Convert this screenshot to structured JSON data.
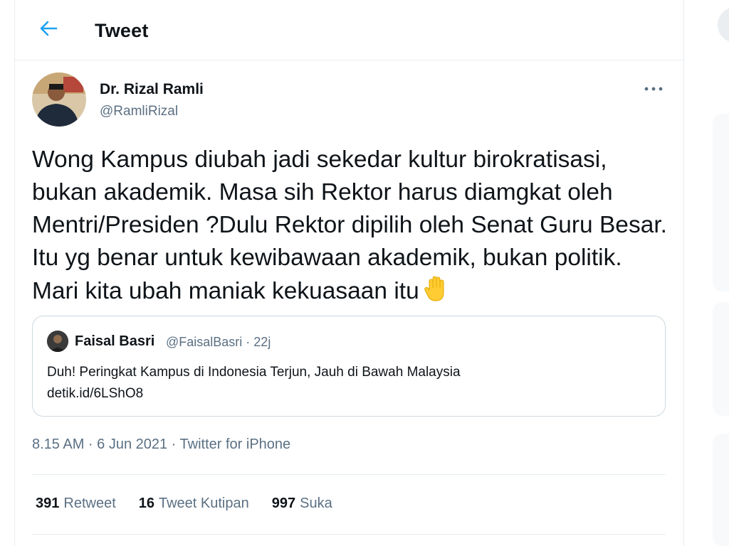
{
  "header": {
    "title": "Tweet",
    "back_icon": "arrow-left-icon",
    "accent_color": "#1da1f2"
  },
  "tweet": {
    "author_name": "Dr. Rizal Ramli",
    "author_handle": "@RamliRizal",
    "text": "Wong Kampus diubah jadi sekedar kultur birokratisasi, bukan akademik. Masa sih Rektor harus diamgkat oleh Mentri/Presiden ?Dulu Rektor dipilih oleh Senat Guru Besar. Itu yg benar untuk kewibawaan akademik, bukan politik. Mari kita ubah maniak kekuasaan itu",
    "emoji_icon": "raised-hand-icon",
    "more_icon": "more-icon",
    "timestamp": "8.15 AM · 6 Jun 2021 · Twitter for iPhone"
  },
  "quote": {
    "author_name": "Faisal Basri",
    "meta": "@FaisalBasri · 22j",
    "text_line1": "Duh! Peringkat Kampus di Indonesia Terjun, Jauh di Bawah Malaysia",
    "text_line2": "detik.id/6LShO8"
  },
  "stats": {
    "retweets_count": "391",
    "retweets_label": "Retweet",
    "quotes_count": "16",
    "quotes_label": "Tweet Kutipan",
    "likes_count": "997",
    "likes_label": "Suka"
  },
  "colors": {
    "text_primary": "#0f1419",
    "text_secondary": "#5b7083",
    "border": "#e6ecf0"
  }
}
